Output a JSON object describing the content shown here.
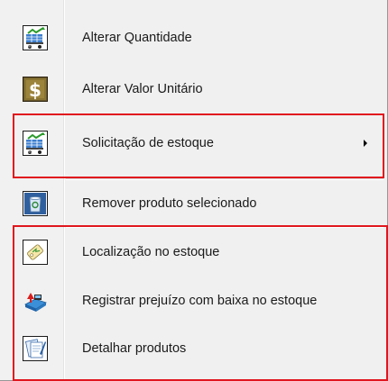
{
  "menu": {
    "items": [
      {
        "label": "Alterar Quantidade",
        "icon": "cart-chart-icon",
        "has_submenu": false
      },
      {
        "label": "Alterar Valor Unitário",
        "icon": "dollar-sign-icon",
        "has_submenu": false
      },
      {
        "label": "Solicitação de estoque",
        "icon": "cart-chart-icon",
        "has_submenu": true
      },
      {
        "label": "Remover produto selecionado",
        "icon": "recycle-bin-icon",
        "has_submenu": false
      },
      {
        "label": "Localização no estoque",
        "icon": "location-tag-icon",
        "has_submenu": false
      },
      {
        "label": "Registrar prejuízo com baixa no estoque",
        "icon": "loss-register-icon",
        "has_submenu": false
      },
      {
        "label": "Detalhar produtos",
        "icon": "product-details-icon",
        "has_submenu": false
      }
    ]
  },
  "colors": {
    "highlight_border": "#e0161e",
    "menu_background": "#f0f0f0"
  }
}
